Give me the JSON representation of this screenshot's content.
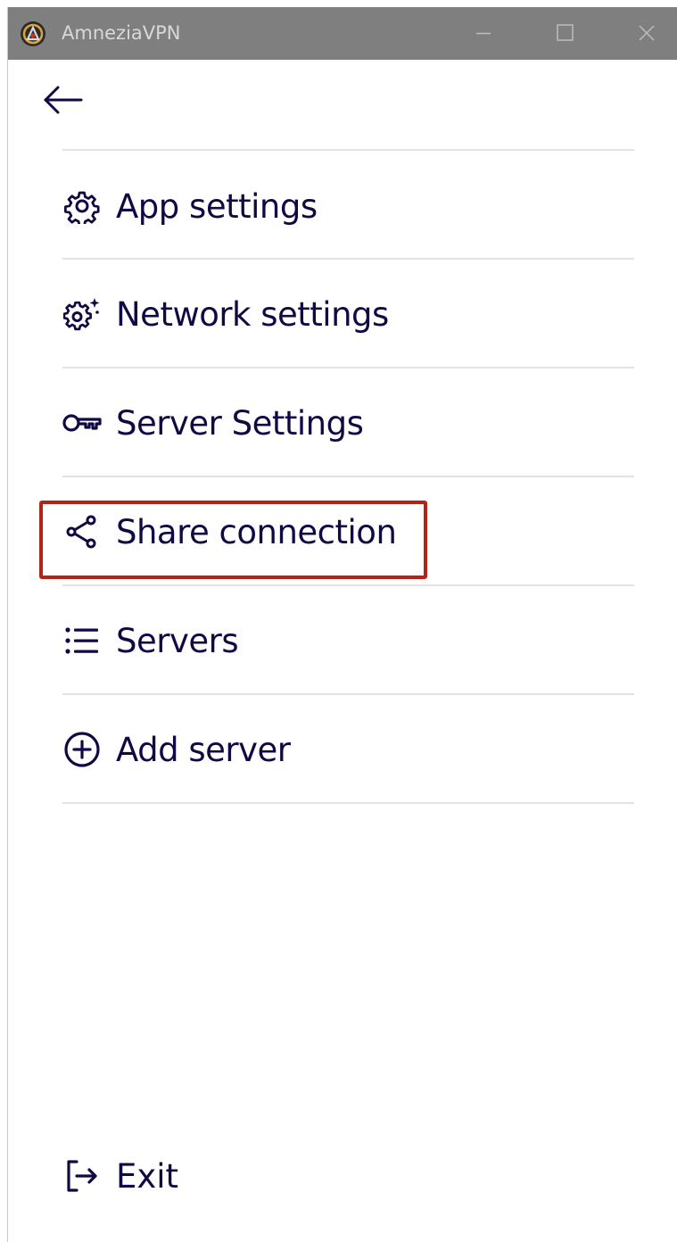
{
  "window": {
    "title": "AmneziaVPN",
    "titlebar_color": "#7f7f7f",
    "title_color": "#d8d8d8"
  },
  "back": {
    "icon": "arrow-left-icon"
  },
  "menu": {
    "text_color": "#100a44",
    "items": [
      {
        "label": "App settings",
        "icon": "gear-icon"
      },
      {
        "label": "Network settings",
        "icon": "gear-sparkle-icon"
      },
      {
        "label": "Server Settings",
        "icon": "key-icon"
      },
      {
        "label": "Share connection",
        "icon": "share-icon",
        "highlighted": true
      },
      {
        "label": "Servers",
        "icon": "list-icon"
      },
      {
        "label": "Add server",
        "icon": "plus-circle-icon"
      }
    ]
  },
  "exit": {
    "label": "Exit",
    "icon": "logout-icon"
  },
  "highlight_color": "#b22415"
}
